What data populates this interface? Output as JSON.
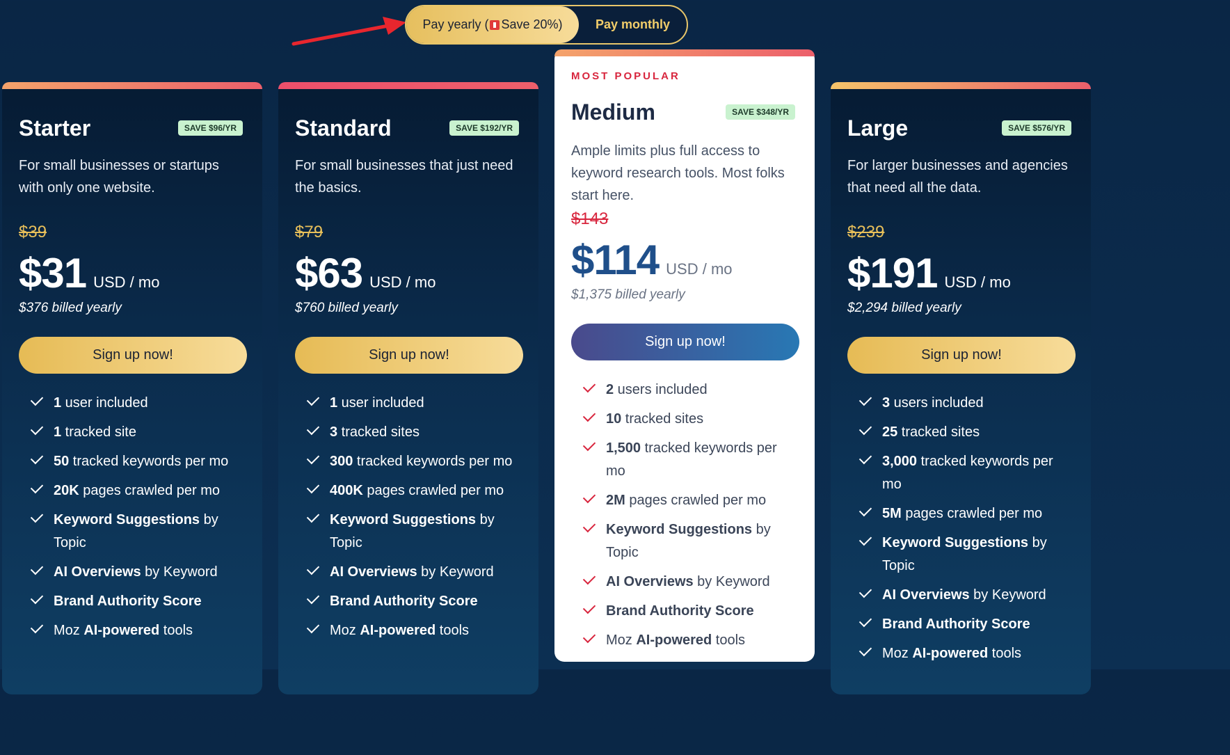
{
  "toggle": {
    "yearly_label_pre": "Pay yearly (",
    "yearly_label_post": " Save 20%)",
    "monthly_label": "Pay monthly",
    "selected": "yearly",
    "flag_icon": "red-flag-emoji"
  },
  "annotation": {
    "arrow_icon": "red-arrow",
    "color": "#e8262e"
  },
  "plans": [
    {
      "name": "Starter",
      "save": "SAVE $96/YR",
      "description": "For small businesses or startups with only one website.",
      "old_price": "$39",
      "price": "$31",
      "unit": "USD / mo",
      "billed": "$376 billed yearly",
      "cta": "Sign up now!",
      "features": [
        {
          "b": "1",
          "t": " user included"
        },
        {
          "b": "1",
          "t": " tracked site"
        },
        {
          "b": "50",
          "t": " tracked keywords per mo"
        },
        {
          "b": "20K",
          "t": " pages crawled per mo"
        },
        {
          "b": "Keyword Suggestions",
          "t": " by Topic"
        },
        {
          "b": "AI Overviews",
          "t": " by Keyword"
        },
        {
          "b": "Brand Authority Score",
          "t": ""
        },
        {
          "b": "AI-powered",
          "pre": "Moz ",
          "t": " tools"
        }
      ]
    },
    {
      "name": "Standard",
      "save": "SAVE $192/YR",
      "description": "For small businesses that just need the basics.",
      "old_price": "$79",
      "price": "$63",
      "unit": "USD / mo",
      "billed": "$760 billed yearly",
      "cta": "Sign up now!",
      "features": [
        {
          "b": "1",
          "t": " user included"
        },
        {
          "b": "3",
          "t": " tracked sites"
        },
        {
          "b": "300",
          "t": " tracked keywords per mo"
        },
        {
          "b": "400K",
          "t": " pages crawled per mo"
        },
        {
          "b": "Keyword Suggestions",
          "t": " by Topic"
        },
        {
          "b": "AI Overviews",
          "t": " by Keyword"
        },
        {
          "b": "Brand Authority Score",
          "t": ""
        },
        {
          "b": "AI-powered",
          "pre": "Moz ",
          "t": " tools"
        }
      ]
    },
    {
      "popular": "MOST POPULAR",
      "name": "Medium",
      "save": "SAVE $348/YR",
      "description": "Ample limits plus full access to keyword research tools. Most folks start here.",
      "old_price": "$143",
      "price": "$114",
      "unit": "USD / mo",
      "billed": "$1,375 billed yearly",
      "cta": "Sign up now!",
      "features": [
        {
          "b": "2",
          "t": " users included"
        },
        {
          "b": "10",
          "t": " tracked sites"
        },
        {
          "b": "1,500",
          "t": " tracked keywords per mo"
        },
        {
          "b": "2M",
          "t": " pages crawled per mo"
        },
        {
          "b": "Keyword Suggestions",
          "t": " by Topic"
        },
        {
          "b": "AI Overviews",
          "t": " by Keyword"
        },
        {
          "b": "Brand Authority Score",
          "t": ""
        },
        {
          "b": "AI-powered",
          "pre": "Moz ",
          "t": " tools"
        }
      ]
    },
    {
      "name": "Large",
      "save": "SAVE $576/YR",
      "description": "For larger businesses and agencies that need all the data.",
      "old_price": "$239",
      "price": "$191",
      "unit": "USD / mo",
      "billed": "$2,294 billed yearly",
      "cta": "Sign up now!",
      "features": [
        {
          "b": "3",
          "t": " users included"
        },
        {
          "b": "25",
          "t": " tracked sites"
        },
        {
          "b": "3,000",
          "t": " tracked keywords per mo"
        },
        {
          "b": "5M",
          "t": " pages crawled per mo"
        },
        {
          "b": "Keyword Suggestions",
          "t": " by Topic"
        },
        {
          "b": "AI Overviews",
          "t": " by Keyword"
        },
        {
          "b": "Brand Authority Score",
          "t": ""
        },
        {
          "b": "AI-powered",
          "pre": "Moz ",
          "t": " tools"
        }
      ]
    }
  ]
}
